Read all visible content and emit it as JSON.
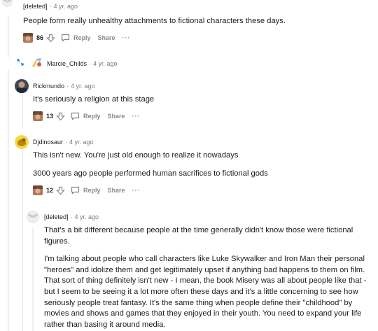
{
  "comments": [
    {
      "author": "[deleted]",
      "time": "4 yr. ago",
      "body": [
        "People form really unhealthy attachments to fictional characters these days."
      ],
      "score": "86",
      "reply_label": "Reply",
      "share_label": "Share",
      "more_label": "···"
    },
    {
      "author": "Marcie_Childs",
      "time": "4 yr. ago"
    },
    {
      "author": "Rickmundo",
      "time": "4 yr. ago",
      "body": [
        "It's seriously a religion at this stage"
      ],
      "score": "13",
      "reply_label": "Reply",
      "share_label": "Share",
      "more_label": "···"
    },
    {
      "author": "Djdinosaur",
      "time": "4 yr. ago",
      "body": [
        "This isn't new. You're just old enough to realize it nowadays",
        "3000 years ago people performed human sacrifices to fictional gods"
      ],
      "score": "12",
      "reply_label": "Reply",
      "share_label": "Share",
      "more_label": "···"
    },
    {
      "author": "[deleted]",
      "time": "4 yr. ago",
      "body": [
        "That's a bit different because people at the time generally didn't know those were fictional figures.",
        "I'm talking about people who call characters like Luke Skywalker and Iron Man their personal \"heroes\" and idolize them and get legitimately upset if anything bad happens to them on film. That sort of thing definitely isn't new - I mean, the book Misery was all about people like that - but I seem to be seeing it a lot more often these days and it's a little concerning to see how seriously people treat fantasy. It's the same thing when people define their \"childhood\" by movies and shows and games that they enjoyed in their youth. You need to expand your life rather than basing it around media."
      ]
    }
  ],
  "colors": {
    "thread_line": "#edeff1",
    "meta_gray": "#7c7c7c",
    "action_gray": "#878a8c",
    "text": "#1c1c1c"
  }
}
